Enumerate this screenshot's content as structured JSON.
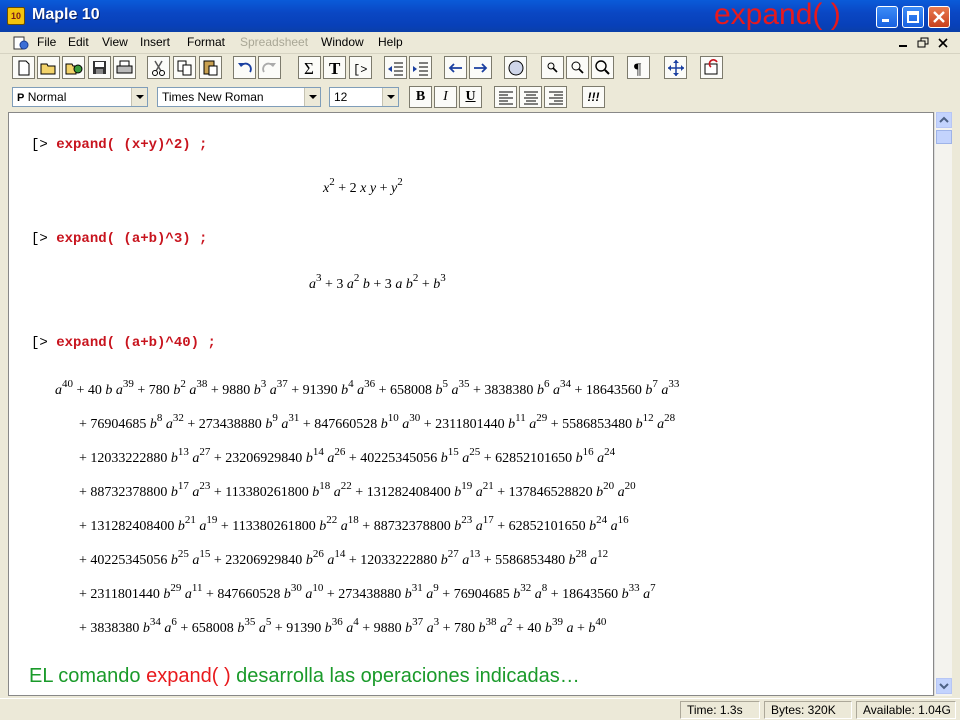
{
  "window": {
    "app_title": "Maple 10",
    "slide_title": "expand( )"
  },
  "menu": {
    "items": [
      {
        "label": "File",
        "enabled": true
      },
      {
        "label": "Edit",
        "enabled": true
      },
      {
        "label": "View",
        "enabled": true
      },
      {
        "label": "Insert",
        "enabled": true
      },
      {
        "label": "Format",
        "enabled": true
      },
      {
        "label": "Spreadsheet",
        "enabled": false
      },
      {
        "label": "Window",
        "enabled": true
      },
      {
        "label": "Help",
        "enabled": true
      }
    ]
  },
  "formatbar": {
    "style": "Normal",
    "style_prefix": "P",
    "font": "Times New Roman",
    "size": "12",
    "bold_label": "B",
    "italic_label": "I",
    "underline_label": "U",
    "exec_label": "!!!"
  },
  "worksheet": {
    "prompt": "[>",
    "command_1": "expand( (x+y)^2) ;",
    "command_2": "expand( (a+b)^3) ;",
    "command_3": "expand( (a+b)^40) ;",
    "note_black": "EL comando ",
    "note_red": "expand( )",
    "note_green": " desarrolla las operaciones indicadas…"
  },
  "status": {
    "time": "Time:  1.3s",
    "bytes": "Bytes:  320K",
    "available": "Available:  1.04G"
  },
  "colors": {
    "command": "#c8141e",
    "note_black": "#1a9a2a",
    "note_red": "#e8191c",
    "note_green": "#1a9a2a",
    "slide_title": "#e8191c"
  }
}
